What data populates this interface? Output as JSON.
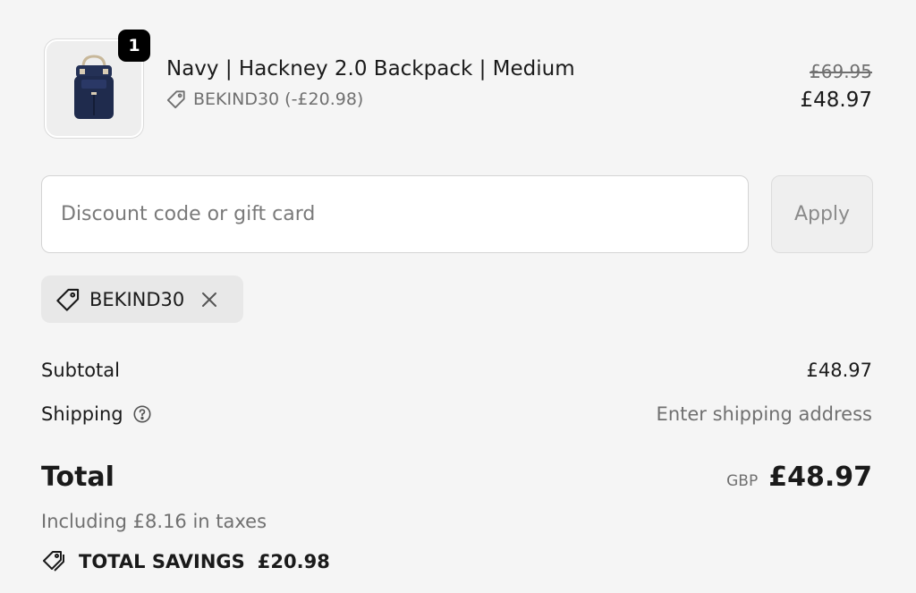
{
  "product": {
    "quantity": "1",
    "name": "Navy | Hackney 2.0 Backpack | Medium",
    "discount_line": "BEKIND30 (-£20.98)",
    "original_price": "£69.95",
    "price": "£48.97",
    "image_icon": "backpack-icon"
  },
  "discount": {
    "placeholder": "Discount code or gift card",
    "value": "",
    "apply_label": "Apply",
    "applied_code": "BEKIND30",
    "tag_icon": "tag-icon",
    "remove_icon": "close-icon"
  },
  "summary": {
    "subtotal_label": "Subtotal",
    "subtotal_value": "£48.97",
    "shipping_label": "Shipping",
    "shipping_value": "Enter shipping address",
    "shipping_help_icon": "help-icon",
    "total_label": "Total",
    "currency": "GBP",
    "total_value": "£48.97",
    "taxes_text": "Including £8.16 in taxes",
    "savings_label": "TOTAL SAVINGS",
    "savings_value": "£20.98",
    "savings_icon": "tags-icon"
  },
  "colors": {
    "background": "#f5f5f5",
    "badge": "#000000",
    "muted_text": "#707070",
    "backpack_navy": "#1f2b4d"
  }
}
